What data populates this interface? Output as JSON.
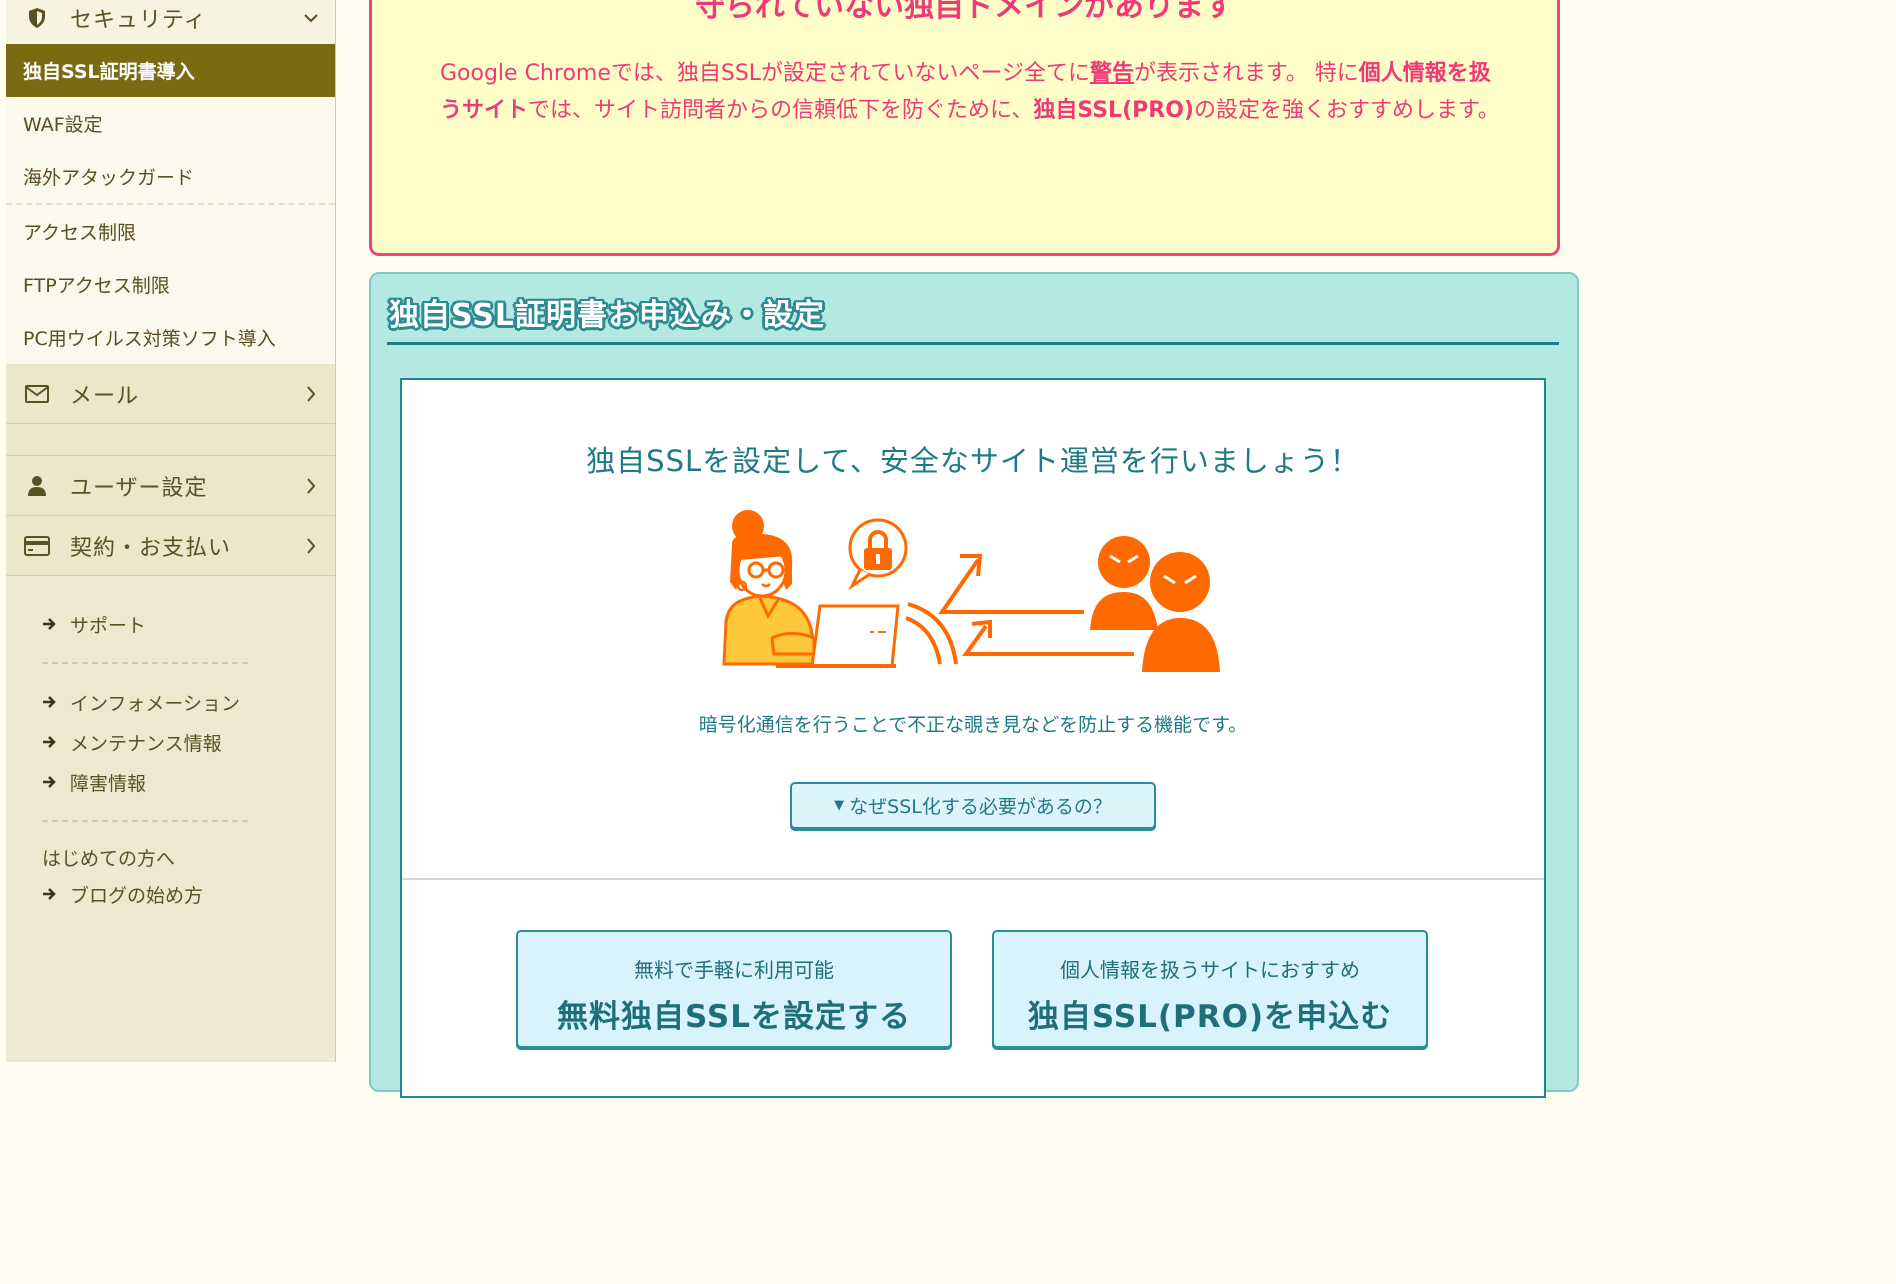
{
  "sidebar": {
    "security": {
      "label": "セキュリティ",
      "icon": "shield-icon"
    },
    "security_items": [
      "独自SSL証明書導入",
      "WAF設定",
      "海外アタックガード",
      "アクセス制限",
      "FTPアクセス制限",
      "PC用ウイルス対策ソフト導入"
    ],
    "mail": {
      "label": "メール",
      "icon": "mail-icon"
    },
    "user": {
      "label": "ユーザー設定",
      "icon": "user-icon"
    },
    "billing": {
      "label": "契約・お支払い",
      "icon": "card-icon"
    },
    "links": {
      "support": "サポート",
      "information": "インフォメーション",
      "maintenance": "メンテナンス情報",
      "incident": "障害情報",
      "beginners": "はじめての方へ",
      "blog": "ブログの始め方"
    }
  },
  "warning": {
    "title": "守られていない独自ドメインがあります",
    "body_1": "Google Chromeでは、独自SSLが設定されていないページ全てに",
    "body_link": "警告",
    "body_2": "が表示されます。 特に",
    "body_bold_1": "個人情報を扱うサイト",
    "body_3": "では、サイト訪問者からの信頼低下を防ぐために、",
    "body_bold_2": "独自SSL(PRO)",
    "body_4": "の設定を強くおすすめします。"
  },
  "ssl": {
    "title": "独自SSL証明書お申込み・設定",
    "lead": "独自SSLを設定して、安全なサイト運営を行いましょう！",
    "description": "暗号化通信を行うことで不正な覗き見などを防止する機能です。",
    "why_button": "なぜSSL化する必要があるの？",
    "free": {
      "sub": "無料で手軽に利用可能",
      "main": "無料独自SSLを設定する"
    },
    "pro": {
      "sub": "個人情報を扱うサイトにおすすめ",
      "main": "独自SSL(PRO)を申込む"
    }
  },
  "colors": {
    "sidebar_active": "#7a6a12",
    "warning_pink": "#ee3a77",
    "warning_bg": "#fffec8",
    "panel_teal": "#b4e8e2",
    "teal_text": "#1e7a86",
    "illustration_orange": "#ff6a00"
  }
}
